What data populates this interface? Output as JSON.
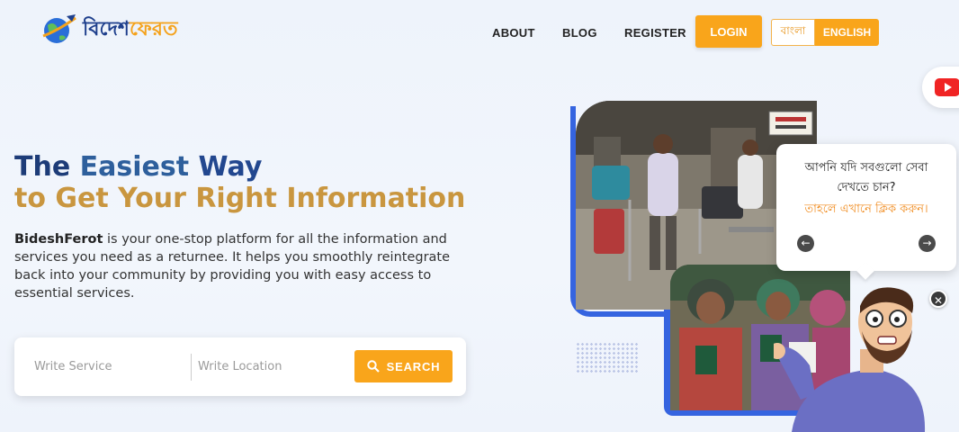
{
  "brand": {
    "part1": "বিদেশ",
    "part2": "ফেরত"
  },
  "nav": {
    "about": "ABOUT",
    "blog": "BLOG",
    "register": "REGISTER",
    "login": "LOGIN"
  },
  "language": {
    "bangla": "বাংলা",
    "english": "ENGLISH",
    "selected": "ENGLISH"
  },
  "hero": {
    "title_line1_part1": "The",
    "title_line1_part2": "Easiest",
    "title_line1_part3": "Way",
    "title_line2": "to Get Your Right Information",
    "desc_brand": "BideshFerot",
    "desc_rest": " is your one-stop platform for all the information and services you need as a returnee. It helps you smoothly reintegrate back into your community by providing you with easy access to essential services."
  },
  "search": {
    "service_placeholder": "Write Service",
    "location_placeholder": "Write Location",
    "button_label": "SEARCH"
  },
  "chat_bubble": {
    "text": "আপনি যদি সবগুলো সেবা দেখতে চান?",
    "link": "তাহলে এখানে ক্লিক করুন।"
  },
  "colors": {
    "accent": "#f9a51b",
    "navy": "#1d3c78",
    "gold": "#c9963f",
    "frame_blue": "#3564e0"
  },
  "icons": {
    "youtube": "youtube-icon",
    "search": "search-icon",
    "prev": "arrow-left-icon",
    "next": "arrow-right-icon",
    "close": "close-icon"
  }
}
